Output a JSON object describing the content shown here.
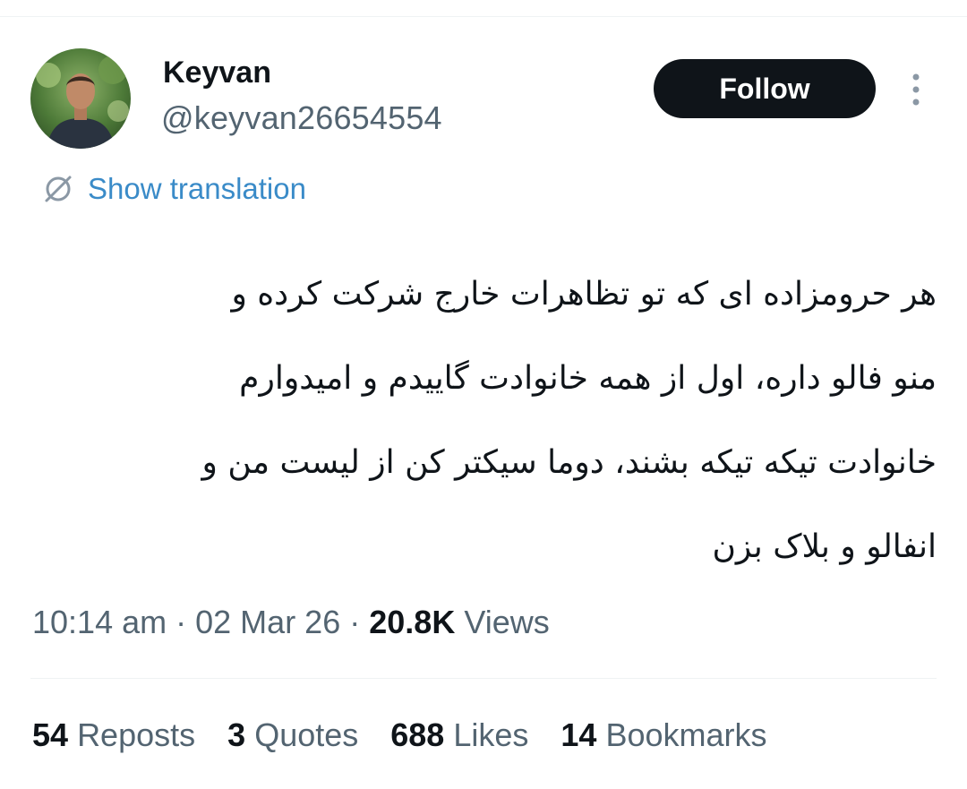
{
  "author": {
    "name": "Keyvan",
    "handle": "@keyvan26654554"
  },
  "actions": {
    "follow_label": "Follow",
    "more_icon": "more-vertical-icon"
  },
  "translation": {
    "label": "Show translation",
    "icon": "translate-icon"
  },
  "tweet": {
    "lines": [
      "هر حرومزاده ای که تو تظاهرات خارج شرکت کرده و",
      "منو فالو داره، اول از همه خانوادت گاییدم و امیدوارم",
      "خانوادت تیکه تیکه بشند، دوما سیکتر کن از لیست من و",
      "انفالو و بلاک بزن"
    ]
  },
  "meta": {
    "time": "10:14 am",
    "separator": "·",
    "date": "02 Mar 26",
    "views_count": "20.8K",
    "views_label": "Views"
  },
  "stats": {
    "reposts_count": "54",
    "reposts_label": "Reposts",
    "quotes_count": "3",
    "quotes_label": "Quotes",
    "likes_count": "688",
    "likes_label": "Likes",
    "bookmarks_count": "14",
    "bookmarks_label": "Bookmarks"
  },
  "colors": {
    "text_primary": "#0f1419",
    "text_secondary": "#536471",
    "link": "#3a8bc8",
    "button_bg": "#0f1419"
  }
}
